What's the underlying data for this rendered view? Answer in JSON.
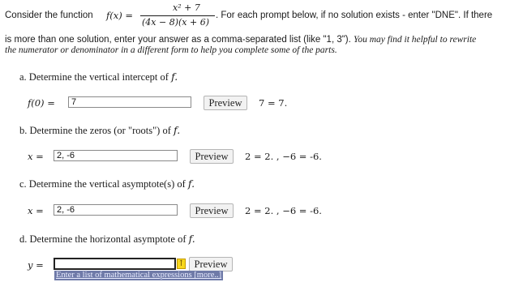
{
  "prompt": {
    "intro": "Consider the function",
    "fx": "f(x) =",
    "numerator": "x² + 7",
    "denominator": "(4x − 8)(x + 6)",
    "line1_tail": ". For each prompt below, if no solution exists - enter \"DNE\". If there",
    "line2_plain": "is more than one solution, enter your answer as a comma-separated list (like \"1, 3\"). ",
    "line2_italic": "You may find it helpful to rewrite",
    "line3_italic": "the numerator or denominator in a different form to help you complete some of the parts."
  },
  "parts": {
    "a": {
      "question_text": "a. Determine the vertical intercept of ",
      "question_var": "f.",
      "label": "f(0) =",
      "value": "7",
      "preview_label": "Preview",
      "result": "7 = 7."
    },
    "b": {
      "question_text": "b. Determine the zeros (or \"roots\") of ",
      "question_var": "f.",
      "label": "x =",
      "value": "2, -6",
      "preview_label": "Preview",
      "result": "2 = 2. , −6 = -6."
    },
    "c": {
      "question_text": "c. Determine the vertical asymptote(s) of ",
      "question_var": "f.",
      "label": "x =",
      "value": "2, -6",
      "preview_label": "Preview",
      "result": "2 = 2. , −6 = -6."
    },
    "d": {
      "question_text": "d. Determine the horizontal asymptote of ",
      "question_var": "f.",
      "label": "y =",
      "value": "",
      "preview_label": "Preview",
      "hint": "Enter a list of mathematical expressions [more..]",
      "arrow_icon": "up-arrow-icon"
    }
  }
}
